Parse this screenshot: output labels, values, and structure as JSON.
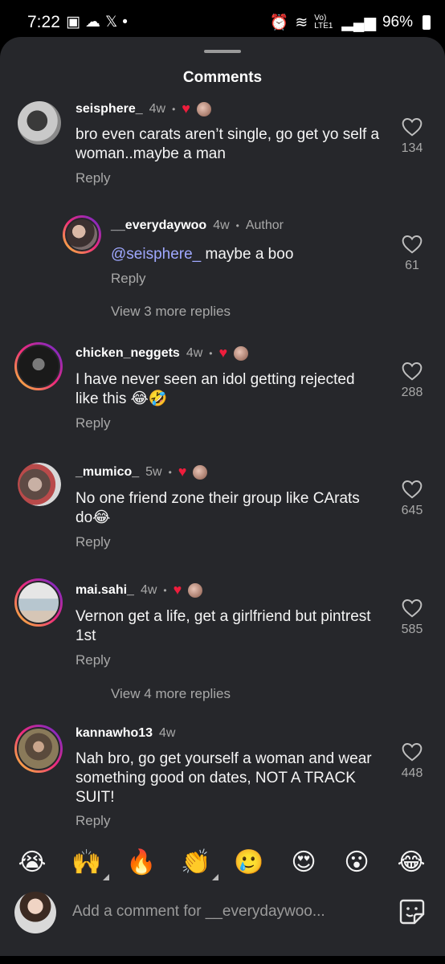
{
  "status_bar": {
    "time": "7:22",
    "left_icons": [
      "gallery-icon",
      "cloud-icon",
      "x-icon",
      "dot-icon"
    ],
    "network": "Vo) LTE1",
    "battery": "96%"
  },
  "sheet": {
    "title": "Comments"
  },
  "comments": [
    {
      "username": "seisphere_",
      "time": "4w",
      "text": "bro even carats aren’t single, go get yo self a woman..maybe a man",
      "reply_label": "Reply",
      "likes": "134"
    },
    {
      "username": "__everydaywoo",
      "time": "4w",
      "author_tag": "Author",
      "mention": "@seisphere_",
      "text": " maybe a boo",
      "reply_label": "Reply",
      "likes": "61"
    },
    {
      "username": "chicken_neggets",
      "time": "4w",
      "text": "I have never seen an idol getting rejected like this 😂🤣",
      "reply_label": "Reply",
      "likes": "288"
    },
    {
      "username": "_mumico_",
      "time": "5w",
      "text": "No one friend zone their group like CArats do😂",
      "reply_label": "Reply",
      "likes": "645"
    },
    {
      "username": "mai.sahi_",
      "time": "4w",
      "text": "Vernon get a life, get a girlfriend but pintrest 1st",
      "reply_label": "Reply",
      "likes": "585"
    },
    {
      "username": "kannawho13",
      "time": "4w",
      "text": "Nah bro, go get yourself a woman and wear something good on dates, NOT A TRACK SUIT!",
      "reply_label": "Reply",
      "likes": "448"
    }
  ],
  "view_more": [
    "View 3 more replies",
    "View 4 more replies"
  ],
  "emoji_bar": [
    "😭",
    "🙌",
    "🔥",
    "👏",
    "🥲",
    "😍",
    "😮",
    "😂"
  ],
  "composer": {
    "placeholder": "Add a comment for __everydaywoo..."
  },
  "colors": {
    "sheet_bg": "#26272b",
    "mention": "#9fa8ff",
    "heart": "#ee1d3c",
    "muted": "#a8a8a8"
  }
}
